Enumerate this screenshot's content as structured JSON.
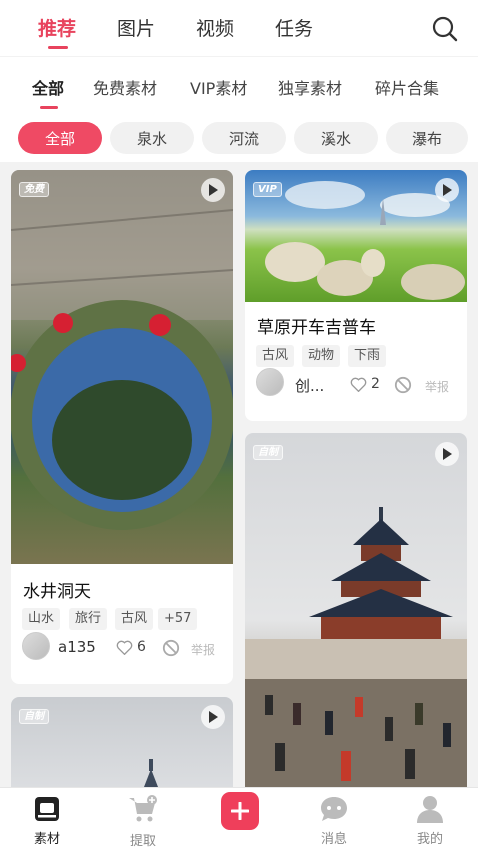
{
  "top_tabs": [
    {
      "label": "推荐",
      "active": true
    },
    {
      "label": "图片",
      "active": false
    },
    {
      "label": "视频",
      "active": false
    },
    {
      "label": "任务",
      "active": false
    }
  ],
  "categories": [
    {
      "label": "全部",
      "active": true
    },
    {
      "label": "免费素材",
      "active": false
    },
    {
      "label": "VIP素材",
      "active": false
    },
    {
      "label": "独享素材",
      "active": false
    },
    {
      "label": "碎片合集",
      "active": false
    }
  ],
  "chips": [
    {
      "label": "全部",
      "active": true
    },
    {
      "label": "泉水",
      "active": false
    },
    {
      "label": "河流",
      "active": false
    },
    {
      "label": "溪水",
      "active": false
    },
    {
      "label": "瀑布",
      "active": false
    }
  ],
  "cards": [
    {
      "badge": "免费",
      "title": "水井洞天",
      "tags": [
        "山水",
        "旅行",
        "古风",
        "+57"
      ],
      "author": "a135",
      "likes": "6",
      "report": "举报"
    },
    {
      "badge": "VIP",
      "title": "草原开车吉普车",
      "tags": [
        "古风",
        "动物",
        "下雨"
      ],
      "author": "创...",
      "likes": "2",
      "report": "举报"
    },
    {
      "badge": "自制"
    },
    {
      "badge": "自制"
    }
  ],
  "bottom_nav": [
    {
      "label": "素材",
      "icon": "material-icon",
      "active": true
    },
    {
      "label": "提取",
      "icon": "cart-icon",
      "active": false
    },
    {
      "label": "",
      "icon": "plus-icon",
      "active": false
    },
    {
      "label": "消息",
      "icon": "message-icon",
      "active": false
    },
    {
      "label": "我的",
      "icon": "profile-icon",
      "active": false
    }
  ],
  "colors": {
    "accent": "#e8435d",
    "background": "#f2f2f2"
  }
}
